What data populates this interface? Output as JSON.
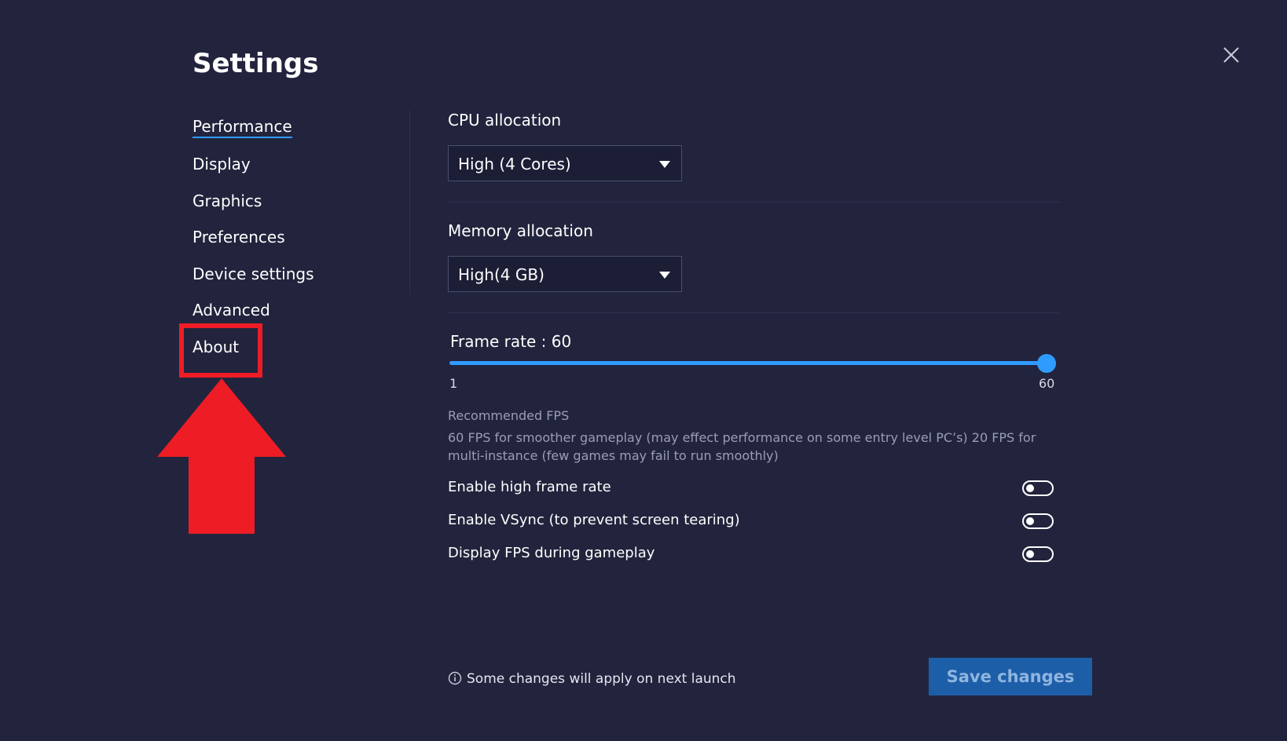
{
  "page": {
    "title": "Settings"
  },
  "sidebar": {
    "items": [
      {
        "label": "Performance",
        "active": true
      },
      {
        "label": "Display"
      },
      {
        "label": "Graphics"
      },
      {
        "label": "Preferences"
      },
      {
        "label": "Device settings"
      },
      {
        "label": "Advanced"
      },
      {
        "label": "About",
        "highlighted": true
      }
    ]
  },
  "performance": {
    "cpu": {
      "label": "CPU allocation",
      "selected": "High (4 Cores)"
    },
    "memory": {
      "label": "Memory allocation",
      "selected": "High(4 GB)"
    },
    "frame_rate": {
      "label": "Frame rate : 60",
      "value": 60,
      "min": 1,
      "max": 60,
      "min_label": "1",
      "max_label": "60"
    },
    "recommended": {
      "heading": "Recommended FPS",
      "text": "60 FPS for smoother gameplay (may effect performance on some entry level PC’s) 20 FPS for multi-instance (few games may fail to run smoothly)"
    },
    "toggles": [
      {
        "label": "Enable high frame rate",
        "on": false
      },
      {
        "label": "Enable VSync (to prevent screen tearing)",
        "on": false
      },
      {
        "label": "Display FPS during gameplay",
        "on": false
      }
    ]
  },
  "footer": {
    "note": "Some changes will apply on next launch",
    "save_label": "Save changes"
  },
  "colors": {
    "background": "#22243d",
    "accent": "#2f9bff",
    "save_button": "#1d5ea8",
    "annotation": "#ee1c25"
  },
  "icons": {
    "close": "close-icon",
    "dropdown": "caret-down-icon",
    "info": "info-icon",
    "annotation": "arrow-up-icon"
  }
}
